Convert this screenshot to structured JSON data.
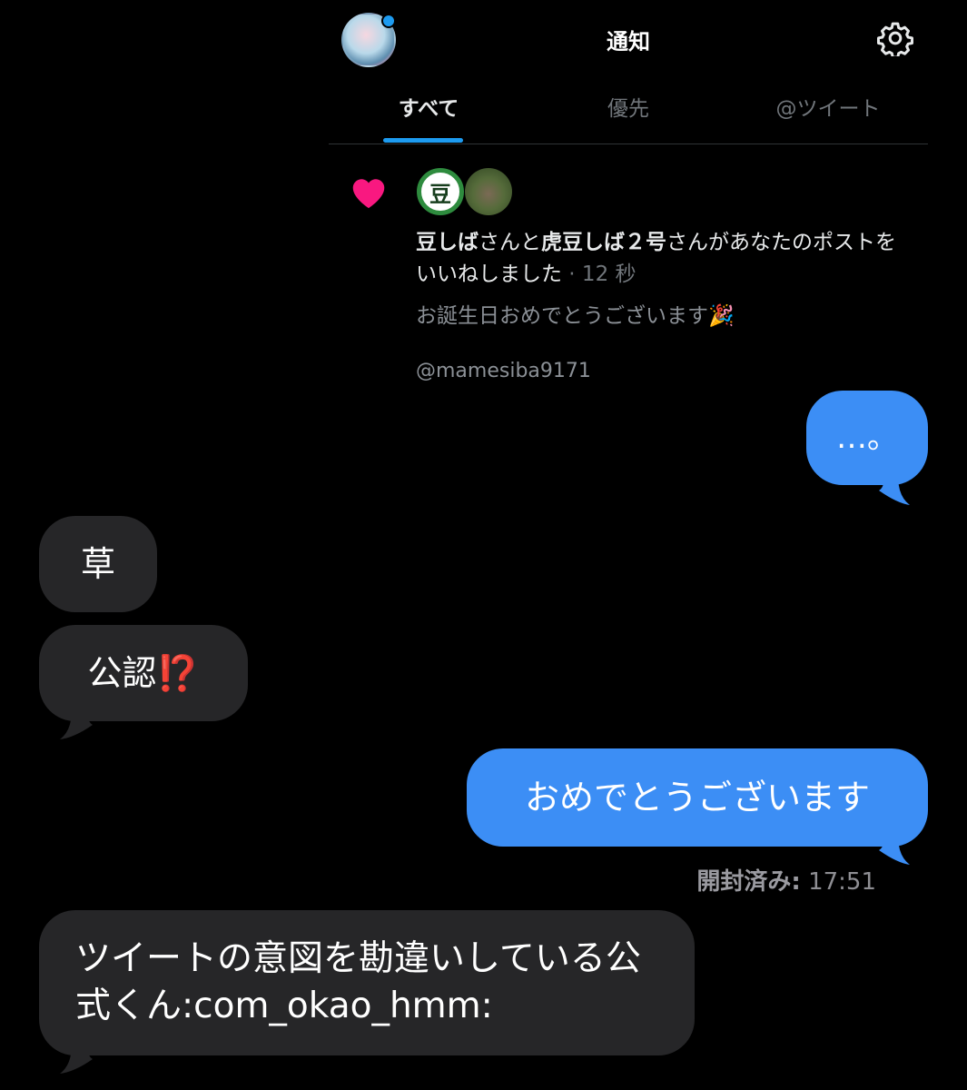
{
  "notifications_panel": {
    "title": "通知",
    "tabs": [
      "すべて",
      "優先",
      "@ツイート"
    ],
    "active_tab": "すべて",
    "notification": {
      "user1": "豆しば",
      "connector1": "さんと",
      "user2": "虎豆しば２号",
      "connector2": "さんがあなたのポストを",
      "line2": "いいねしました",
      "time": " · 12 秒",
      "post_text": "お誕生日おめでとうございます🎉",
      "handle": "@mamesiba9171",
      "avatar1_glyph": "豆"
    },
    "icons": [
      "profile-avatar",
      "gear-icon",
      "heart-icon"
    ],
    "colors": {
      "accent": "#1d9bf0",
      "heart": "#f91880"
    }
  },
  "messages": [
    {
      "side": "out",
      "text": "…。"
    },
    {
      "side": "in",
      "text": "草"
    },
    {
      "side": "in",
      "text": "公認",
      "emoji": "⁉️"
    },
    {
      "side": "out",
      "text": "おめでとうございます"
    },
    {
      "side": "in",
      "text": "ツイートの意図を勘違いしている公式くん:com_okao_hmm:"
    }
  ],
  "read_receipt": {
    "label": "開封済み:",
    "time": "17:51"
  },
  "colors": {
    "outgoing_bubble": "#3c8ef5",
    "incoming_bubble": "#262628",
    "background": "#000000"
  }
}
